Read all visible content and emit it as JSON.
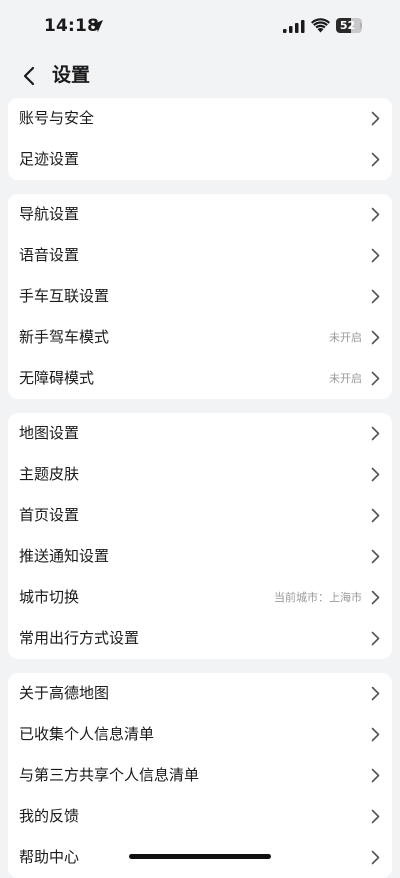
{
  "status_bar": {
    "time": "14:18",
    "battery": "52",
    "battery_level_percent": 52
  },
  "header": {
    "title": "设置"
  },
  "groups": [
    {
      "items": [
        {
          "label": "账号与安全",
          "value": ""
        },
        {
          "label": "足迹设置",
          "value": ""
        }
      ]
    },
    {
      "items": [
        {
          "label": "导航设置",
          "value": ""
        },
        {
          "label": "语音设置",
          "value": ""
        },
        {
          "label": "手车互联设置",
          "value": ""
        },
        {
          "label": "新手驾车模式",
          "value": "未开启"
        },
        {
          "label": "无障碍模式",
          "value": "未开启"
        }
      ]
    },
    {
      "items": [
        {
          "label": "地图设置",
          "value": ""
        },
        {
          "label": "主题皮肤",
          "value": ""
        },
        {
          "label": "首页设置",
          "value": ""
        },
        {
          "label": "推送通知设置",
          "value": ""
        },
        {
          "label": "城市切换",
          "value": "当前城市：上海市"
        },
        {
          "label": "常用出行方式设置",
          "value": ""
        }
      ]
    },
    {
      "items": [
        {
          "label": "关于高德地图",
          "value": ""
        },
        {
          "label": "已收集个人信息清单",
          "value": ""
        },
        {
          "label": "与第三方共享个人信息清单",
          "value": ""
        },
        {
          "label": "我的反馈",
          "value": ""
        },
        {
          "label": "帮助中心",
          "value": ""
        }
      ]
    }
  ]
}
